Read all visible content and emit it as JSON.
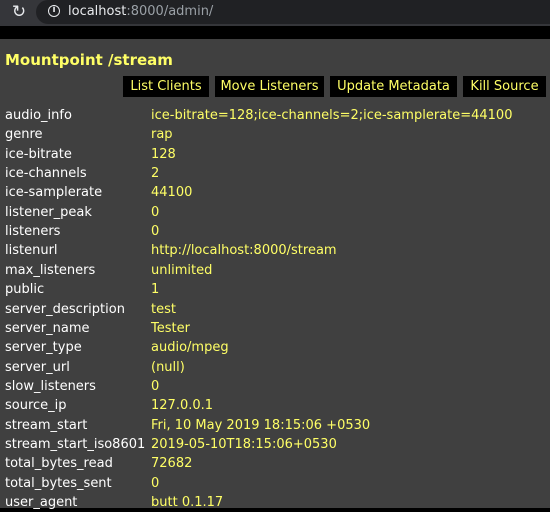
{
  "browser": {
    "reload_glyph": "↻",
    "url_host": "localhost",
    "url_rest": ":8000/admin/"
  },
  "mount": {
    "title": "Mountpoint /stream"
  },
  "actions": {
    "list_clients": "List Clients",
    "move_listeners": "Move Listeners",
    "update_metadata": "Update Metadata",
    "kill_source": "Kill Source"
  },
  "stats": [
    {
      "key": "audio_info",
      "value": "ice-bitrate=128;ice-channels=2;ice-samplerate=44100"
    },
    {
      "key": "genre",
      "value": "rap"
    },
    {
      "key": "ice-bitrate",
      "value": "128"
    },
    {
      "key": "ice-channels",
      "value": "2"
    },
    {
      "key": "ice-samplerate",
      "value": "44100"
    },
    {
      "key": "listener_peak",
      "value": "0"
    },
    {
      "key": "listeners",
      "value": "0"
    },
    {
      "key": "listenurl",
      "value": "http://localhost:8000/stream"
    },
    {
      "key": "max_listeners",
      "value": "unlimited"
    },
    {
      "key": "public",
      "value": "1"
    },
    {
      "key": "server_description",
      "value": "test"
    },
    {
      "key": "server_name",
      "value": "Tester"
    },
    {
      "key": "server_type",
      "value": "audio/mpeg"
    },
    {
      "key": "server_url",
      "value": "(null)"
    },
    {
      "key": "slow_listeners",
      "value": "0"
    },
    {
      "key": "source_ip",
      "value": "127.0.0.1"
    },
    {
      "key": "stream_start",
      "value": "Fri, 10 May 2019 18:15:06 +0530"
    },
    {
      "key": "stream_start_iso8601",
      "value": "2019-05-10T18:15:06+0530"
    },
    {
      "key": "total_bytes_read",
      "value": "72682"
    },
    {
      "key": "total_bytes_sent",
      "value": "0"
    },
    {
      "key": "user_agent",
      "value": "butt 0.1.17"
    }
  ],
  "colors": {
    "content_bg": "#404040",
    "accent_yellow": "#ffff66",
    "label_white": "#ffffff",
    "button_bg": "#000000"
  }
}
